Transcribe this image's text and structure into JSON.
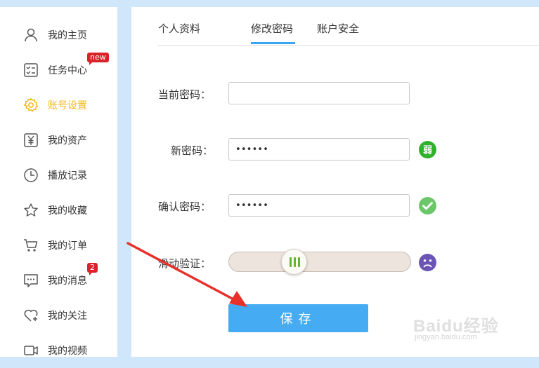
{
  "sidebar": {
    "items": [
      {
        "label": "我的主页",
        "icon": "user-icon"
      },
      {
        "label": "任务中心",
        "icon": "task-list-icon",
        "badge": "new"
      },
      {
        "label": "账号设置",
        "icon": "gear-icon",
        "active": true
      },
      {
        "label": "我的资产",
        "icon": "yen-icon"
      },
      {
        "label": "播放记录",
        "icon": "clock-icon"
      },
      {
        "label": "我的收藏",
        "icon": "star-icon"
      },
      {
        "label": "我的订单",
        "icon": "cart-icon"
      },
      {
        "label": "我的消息",
        "icon": "message-icon",
        "badge": "2"
      },
      {
        "label": "我的关注",
        "icon": "heart-plus-icon"
      },
      {
        "label": "我的视频",
        "icon": "video-icon"
      }
    ]
  },
  "tabs": [
    {
      "label": "个人资料"
    },
    {
      "label": "修改密码",
      "active": true
    },
    {
      "label": "账户安全"
    }
  ],
  "form": {
    "current_password": {
      "label": "当前密码：",
      "value": ""
    },
    "new_password": {
      "label": "新密码：",
      "value": "••••••",
      "strength": "弱"
    },
    "confirm_password": {
      "label": "确认密码：",
      "value": "••••••",
      "status": "check-icon"
    },
    "slide_verify": {
      "label": "滑动验证：",
      "status": "sad-face-icon"
    },
    "save_label": "保存"
  },
  "watermark": {
    "text": "Baidu经验",
    "sub": "jingyan.baidu.com"
  },
  "colors": {
    "accent": "#45acf3",
    "active_nav": "#f3b81a",
    "badge": "#d9232b",
    "weak": "#2fb12b",
    "check": "#6cc66a",
    "sad": "#6b55b4",
    "arrow": "#e8302a"
  }
}
